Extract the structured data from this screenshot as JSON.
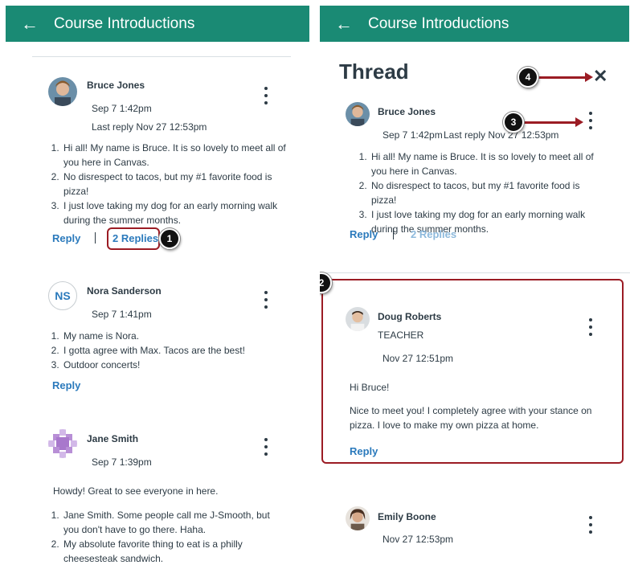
{
  "left": {
    "appbar": {
      "title": "Course Introductions"
    },
    "posts": [
      {
        "author": "Bruce Jones",
        "date": "Sep 7 1:42pm",
        "last_reply": "Last reply Nov 27 12:53pm",
        "items": [
          "Hi all! My name is Bruce. It is so lovely to meet all of you here in Canvas.",
          "No disrespect to tacos, but my #1 favorite food is pizza!",
          "I just love taking my dog for an early morning walk during the summer months."
        ],
        "reply_label": "Reply",
        "replies_label": "2 Replies",
        "callout": "1"
      },
      {
        "author": "Nora Sanderson",
        "initials": "NS",
        "date": "Sep 7 1:41pm",
        "items": [
          "My name is Nora.",
          "I gotta agree with Max. Tacos are the best!",
          "Outdoor concerts!"
        ],
        "reply_label": "Reply"
      },
      {
        "author": "Jane Smith",
        "date": "Sep 7 1:39pm",
        "intro": "Howdy! Great to see everyone in here.",
        "items": [
          "Jane Smith. Some people call me J-Smooth, but you don't have to go there. Haha.",
          "My absolute favorite thing to eat is a philly cheesesteak sandwich."
        ]
      }
    ]
  },
  "right": {
    "appbar": {
      "title": "Course Introductions"
    },
    "thread_title": "Thread",
    "close_glyph": "✕",
    "callouts": {
      "close": "4",
      "menu": "3",
      "reply_box": "2"
    },
    "main_post": {
      "author": "Bruce Jones",
      "date": "Sep 7 1:42pm",
      "last_reply": "Last reply Nov 27 12:53pm",
      "items": [
        "Hi all! My name is Bruce. It is so lovely to meet all of you here in Canvas.",
        "No disrespect to tacos, but my #1 favorite food is pizza!",
        "I just love taking my dog for an early morning walk during the summer months."
      ],
      "reply_label": "Reply",
      "replies_label": "2 Replies"
    },
    "reply_post": {
      "author": "Doug Roberts",
      "role": "TEACHER",
      "date": "Nov 27 12:51pm",
      "greeting": "Hi Bruce!",
      "body": "Nice to meet you! I completely agree with your stance on pizza. I love to make my own pizza at home.",
      "reply_label": "Reply"
    },
    "next_post": {
      "author": "Emily Boone",
      "date": "Nov 27 12:53pm"
    }
  },
  "colors": {
    "appbar": "#1a8a74",
    "link": "#2b7abc",
    "highlight": "#9b1c24",
    "text": "#2d3b45"
  },
  "icons": {
    "back": "arrow-left-icon",
    "menu": "kebab-menu-icon",
    "close": "close-icon"
  }
}
